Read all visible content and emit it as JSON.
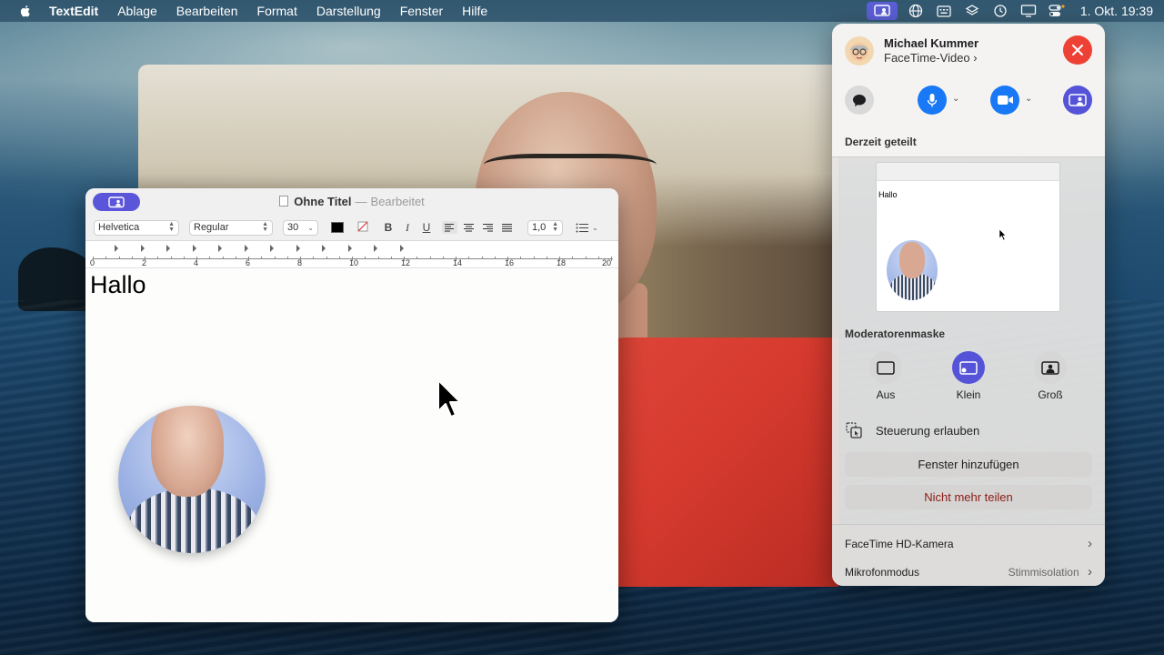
{
  "menubar": {
    "app_name": "TextEdit",
    "items": [
      "Ablage",
      "Bearbeiten",
      "Format",
      "Darstellung",
      "Fenster",
      "Hilfe"
    ],
    "clock": "1. Okt. 19:39",
    "status_icons": [
      "screen-sharing-icon",
      "globe-icon",
      "keyboard-icon",
      "layers-icon",
      "time-machine-icon",
      "display-icon",
      "control-center-icon"
    ]
  },
  "textedit": {
    "title": "Ohne Titel",
    "separator": "—",
    "state": "Bearbeitet",
    "font_family": "Helvetica",
    "font_style": "Regular",
    "font_size": "30",
    "line_spacing": "1,0",
    "bold_label": "B",
    "italic_label": "I",
    "underline_label": "U",
    "ruler_numbers": [
      "0",
      "2",
      "4",
      "6",
      "8",
      "10",
      "12",
      "14",
      "16",
      "18",
      "20"
    ],
    "body_text": "Hallo"
  },
  "facetime": {
    "caller_name": "Michael Kummer",
    "call_type": "FaceTime-Video",
    "shared_section_label": "Derzeit geteilt",
    "preview_text": "Hallo",
    "presenter_section_label": "Moderatorenmaske",
    "modes": [
      {
        "label": "Aus",
        "selected": false
      },
      {
        "label": "Klein",
        "selected": true
      },
      {
        "label": "Groß",
        "selected": false
      }
    ],
    "allow_control_label": "Steuerung erlauben",
    "add_window_label": "Fenster hinzufügen",
    "stop_sharing_label": "Nicht mehr teilen",
    "camera_label": "FaceTime HD-Kamera",
    "mic_mode_label": "Mikrofonmodus",
    "mic_mode_value": "Stimmisolation"
  },
  "colors": {
    "accent_purple": "#5554d8",
    "accent_blue": "#1978f5",
    "close_red": "#ee4034"
  }
}
